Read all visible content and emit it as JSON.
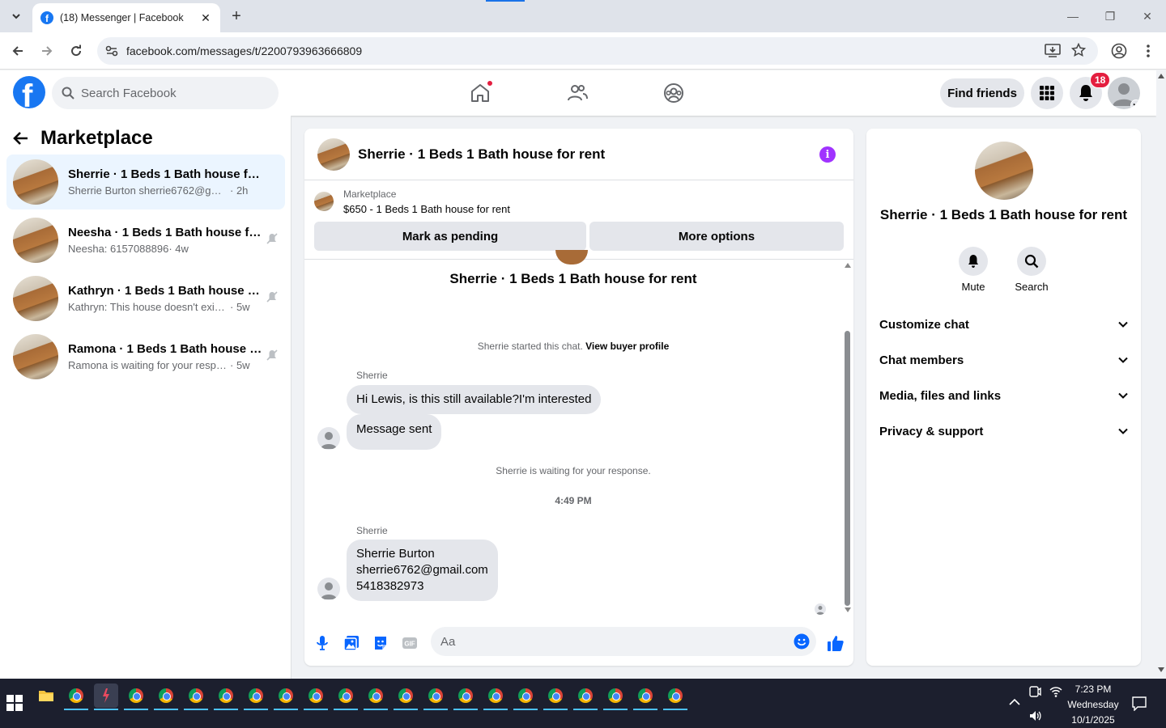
{
  "browser": {
    "tab_title": "(18) Messenger | Facebook",
    "url": "facebook.com/messages/t/2200793963666809"
  },
  "header": {
    "search_placeholder": "Search Facebook",
    "find_friends": "Find friends",
    "notification_count": "18"
  },
  "sidebar": {
    "title": "Marketplace",
    "conversations": [
      {
        "name": "Sherrie · 1 Beds 1 Bath house for re...",
        "preview": "Sherrie Burton sherrie6762@gmail.co...",
        "time": "· 2h"
      },
      {
        "name": "Neesha · 1 Beds 1 Bath house for...",
        "preview": "Neesha: 6157088896",
        "time": "· 4w"
      },
      {
        "name": "Kathryn · 1 Beds 1 Bath house fo...",
        "preview": "Kathryn: This house doesn't exist w...",
        "time": "· 5w"
      },
      {
        "name": "Ramona · 1 Beds 1 Bath house fo...",
        "preview": "Ramona is waiting for your respon...",
        "time": "· 5w"
      }
    ]
  },
  "chat": {
    "title": "Sherrie · 1 Beds 1 Bath house for rent",
    "marketplace_label": "Marketplace",
    "listing": "$650 - 1 Beds 1 Bath house for rent",
    "mark_pending": "Mark as pending",
    "more_options": "More options",
    "conversation_name": "Sherrie · 1 Beds 1 Bath house for rent",
    "started_text": "Sherrie started this chat.",
    "view_buyer": "View buyer profile",
    "sender1": "Sherrie",
    "msg1": "Hi Lewis, is this still available?I'm interested",
    "msg2": "Message sent",
    "waiting": "Sherrie is waiting for your response.",
    "timestamp": "4:49 PM",
    "sender2": "Sherrie",
    "msg3_line1": "Sherrie Burton",
    "msg3_line2": "sherrie6762@gmail.com",
    "msg3_line3": "5418382973",
    "input_placeholder": "Aa"
  },
  "details": {
    "name": "Sherrie · 1 Beds 1 Bath house for rent",
    "mute": "Mute",
    "search": "Search",
    "sections": [
      "Customize chat",
      "Chat members",
      "Media, files and links",
      "Privacy & support"
    ]
  },
  "taskbar": {
    "time": "7:23 PM",
    "day": "Wednesday",
    "date": "10/1/2025"
  },
  "colors": {
    "fb_blue": "#1877f2",
    "active_conv": "#ebf5ff",
    "info_purple": "#a033ff",
    "badge_red": "#e41e3f"
  }
}
